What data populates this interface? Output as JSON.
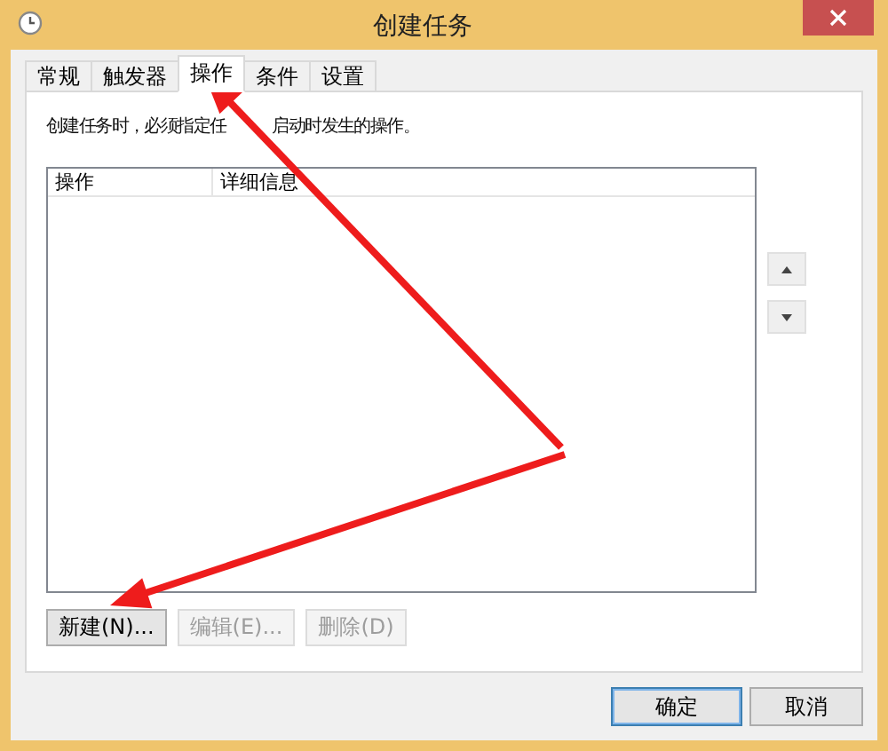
{
  "window": {
    "title": "创建任务"
  },
  "tabs": [
    {
      "label": "常规",
      "selected": false
    },
    {
      "label": "触发器",
      "selected": false
    },
    {
      "label": "操作",
      "selected": true
    },
    {
      "label": "条件",
      "selected": false
    },
    {
      "label": "设置",
      "selected": false
    }
  ],
  "description": {
    "part_1": "创建任务时，必须指定任",
    "part_2": "启动时发生的操作。"
  },
  "actions_table": {
    "columns": [
      "操作",
      "详细信息"
    ]
  },
  "list_buttons": [
    {
      "label": "新建(N)...",
      "disabled": false
    },
    {
      "label": "编辑(E)...",
      "disabled": true
    },
    {
      "label": "删除(D)",
      "disabled": true
    }
  ],
  "dialog_buttons": [
    {
      "label": "确定",
      "default": true
    },
    {
      "label": "取消",
      "default": false
    }
  ]
}
